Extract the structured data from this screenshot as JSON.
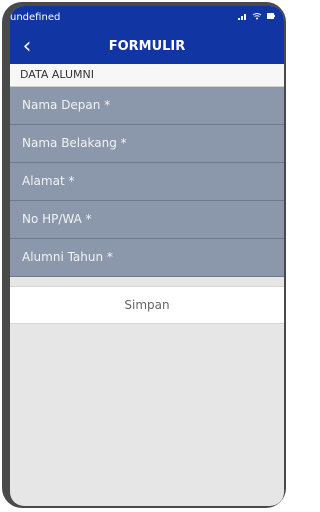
{
  "status": {
    "left_text": "undefined"
  },
  "header": {
    "back_icon": "chevron-left-icon",
    "title": "FORMULIR"
  },
  "section": {
    "title": "DATA ALUMNI"
  },
  "form": {
    "fields": [
      {
        "placeholder": "Nama Depan *"
      },
      {
        "placeholder": "Nama Belakang *"
      },
      {
        "placeholder": "Alamat *"
      },
      {
        "placeholder": "No HP/WA *"
      },
      {
        "placeholder": "Alumni Tahun *"
      }
    ],
    "save_label": "Simpan"
  }
}
